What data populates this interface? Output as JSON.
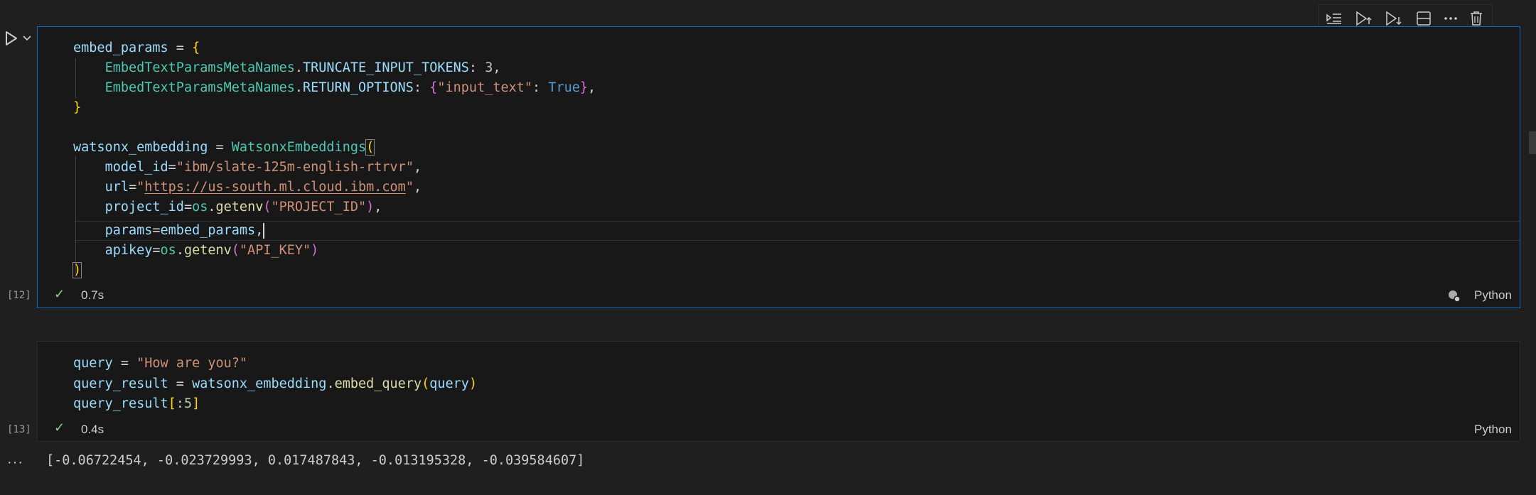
{
  "cells": [
    {
      "execution_count": "[12]",
      "status_time": "0.7s",
      "language": "Python",
      "code_lines": [
        "embed_params = {",
        "EmbedTextParamsMetaNames.TRUNCATE_INPUT_TOKENS: 3,",
        "EmbedTextParamsMetaNames.RETURN_OPTIONS: {\"input_text\": True},",
        "}",
        "",
        "watsonx_embedding = WatsonxEmbeddings(",
        "model_id=\"ibm/slate-125m-english-rtrvr\",",
        "url=\"https://us-south.ml.cloud.ibm.com\",",
        "project_id=os.getenv(\"PROJECT_ID\"),",
        "params=embed_params,",
        "apikey=os.getenv(\"API_KEY\")",
        ")"
      ],
      "tokens": {
        "l1": [
          "embed_params",
          " = ",
          "{"
        ],
        "l2": [
          "EmbedTextParamsMetaNames",
          ".",
          "TRUNCATE_INPUT_TOKENS",
          ": ",
          "3",
          ","
        ],
        "l3": [
          "EmbedTextParamsMetaNames",
          ".",
          "RETURN_OPTIONS",
          ": ",
          "{",
          "\"input_text\"",
          ": ",
          "True",
          "}",
          ","
        ],
        "l4": [
          "}"
        ],
        "l6": [
          "watsonx_embedding",
          " = ",
          "WatsonxEmbeddings",
          "("
        ],
        "l7": [
          "model_id",
          "=",
          "\"ibm/slate-125m-english-rtrvr\"",
          ","
        ],
        "l8": [
          "url",
          "=",
          "\"",
          "https://us-south.ml.cloud.ibm.com",
          "\"",
          ","
        ],
        "l9": [
          "project_id",
          "=",
          "os",
          ".",
          "getenv",
          "(",
          "\"PROJECT_ID\"",
          ")",
          ","
        ],
        "l10": [
          "params",
          "=",
          "embed_params",
          ","
        ],
        "l11": [
          "apikey",
          "=",
          "os",
          ".",
          "getenv",
          "(",
          "\"API_KEY\"",
          ")"
        ],
        "l12": [
          ")"
        ]
      }
    },
    {
      "execution_count": "[13]",
      "status_time": "0.4s",
      "language": "Python",
      "tokens": {
        "l1": [
          "query",
          " = ",
          "\"How are you?\""
        ],
        "l2": [
          "query_result",
          " = ",
          "watsonx_embedding",
          ".",
          "embed_query",
          "(",
          "query",
          ")"
        ],
        "l3": [
          "query_result",
          "[",
          ":",
          "5",
          "]"
        ]
      },
      "output": "[-0.06722454, -0.023729993, 0.017487843, -0.013195328, -0.039584607]"
    }
  ],
  "toolbar": {
    "icons": [
      "run-by-line-icon",
      "run-above-icon",
      "run-below-icon",
      "split-cell-icon",
      "more-icon",
      "delete-icon"
    ]
  },
  "output_menu": "···",
  "colors": {
    "background": "#1f1f1f",
    "cell_background": "#181818",
    "focus_border": "#0f6cbd",
    "success": "#89d185"
  }
}
